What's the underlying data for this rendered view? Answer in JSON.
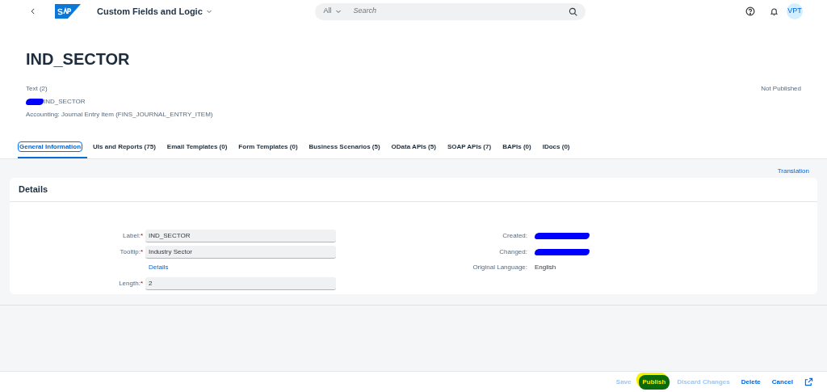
{
  "shell": {
    "title": "Custom Fields and Logic",
    "search": {
      "scope": "All",
      "placeholder": "Search"
    },
    "avatar": "VPT"
  },
  "header": {
    "title": "IND_SECTOR",
    "type": "Text (2)",
    "identifier": "IND_SECTOR",
    "identifier_redacted": true,
    "context": "Accounting: Journal Entry Item (FINS_JOURNAL_ENTRY_ITEM)",
    "status": "Not Published"
  },
  "tabs": [
    {
      "label": "General Information",
      "selected": true
    },
    {
      "label": "UIs and Reports (75)",
      "selected": false
    },
    {
      "label": "Email Templates (0)",
      "selected": false
    },
    {
      "label": "Form Templates (0)",
      "selected": false
    },
    {
      "label": "Business Scenarios (5)",
      "selected": false
    },
    {
      "label": "OData APIs (5)",
      "selected": false
    },
    {
      "label": "SOAP APIs (7)",
      "selected": false
    },
    {
      "label": "BAPIs (0)",
      "selected": false
    },
    {
      "label": "IDocs (0)",
      "selected": false
    }
  ],
  "translation_link": "Translation",
  "details": {
    "title": "Details",
    "fields": [
      {
        "kind": "input",
        "label": "Label:",
        "required_mark": "*",
        "value": "IND_SECTOR"
      },
      {
        "kind": "input",
        "label": "Tooltip:",
        "required_mark": "*",
        "value": "Industry Sector"
      },
      {
        "kind": "link",
        "text": "Details"
      },
      {
        "kind": "input",
        "label": "Length:",
        "required_mark": "*",
        "value": "2"
      }
    ],
    "info": [
      {
        "label": "Created:",
        "redacted": true
      },
      {
        "label": "Changed:",
        "redacted": true
      },
      {
        "label": "Original Language:",
        "value": "English",
        "redacted": false
      }
    ]
  },
  "footer_buttons": [
    {
      "kind": "text",
      "label": "Save",
      "disabled": true,
      "highlighted": false
    },
    {
      "kind": "text",
      "label": "Publish",
      "disabled": false,
      "highlighted": true
    },
    {
      "kind": "text",
      "label": "Discard Changes",
      "disabled": true,
      "highlighted": false
    },
    {
      "kind": "text",
      "label": "Delete",
      "disabled": false,
      "highlighted": false
    },
    {
      "kind": "text",
      "label": "Cancel",
      "disabled": false,
      "highlighted": false
    },
    {
      "kind": "icon",
      "disabled": false,
      "highlighted": false
    }
  ]
}
